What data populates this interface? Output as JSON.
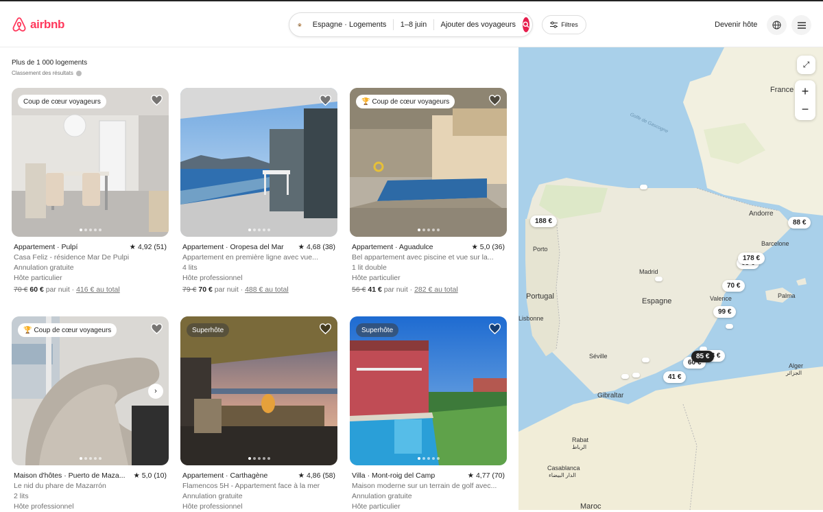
{
  "header": {
    "logo": "airbnb",
    "search": {
      "location": "Espagne · Logements",
      "dates": "1–8 juin",
      "guests": "Ajouter des voyageurs"
    },
    "filters": "Filtres",
    "host": "Devenir hôte"
  },
  "results": {
    "count": "Plus de 1 000 logements",
    "ranking": "Classement des résultats"
  },
  "listings": [
    {
      "badge": "Coup de cœur voyageurs",
      "type": "Appartement · Pulpí",
      "rating": "★ 4,92 (51)",
      "line1": "Casa Feliz - résidence Mar De Pulpi",
      "line2": "Annulation gratuite",
      "line3": "Hôte particulier",
      "old_price": "70 €",
      "price": "60 €",
      "per_night": "par nuit ·",
      "total": "416 € au total"
    },
    {
      "badge": "",
      "type": "Appartement · Oropesa del Mar",
      "rating": "★ 4,68 (38)",
      "line1": "Appartement en première ligne avec vue...",
      "line2": "4 lits",
      "line3": "Hôte professionnel",
      "old_price": "79 €",
      "price": "70 €",
      "per_night": "par nuit ·",
      "total": "488 € au total"
    },
    {
      "badge": "Coup de cœur voyageurs",
      "type": "Appartement · Aguadulce",
      "rating": "★ 5,0 (36)",
      "line1": "Bel appartement avec piscine et vue sur la...",
      "line2": "1 lit double",
      "line3": "Hôte particulier",
      "old_price": "56 €",
      "price": "41 €",
      "per_night": "par nuit ·",
      "total": "282 € au total"
    },
    {
      "badge": "Coup de cœur voyageurs",
      "type": "Maison d'hôtes · Puerto de Maza...",
      "rating": "★ 5,0 (10)",
      "line1": "Le nid du phare de Mazarrón",
      "line2": "2 lits",
      "line3": "Hôte professionnel"
    },
    {
      "badge": "Superhôte",
      "type": "Appartement · Carthagène",
      "rating": "★ 4,86 (58)",
      "line1": "Flamencos 5H - Appartement face à la mer",
      "line2": "Annulation gratuite",
      "line3": "Hôte professionnel"
    },
    {
      "badge": "Superhôte",
      "type": "Villa · Mont-roig del Camp",
      "rating": "★ 4,77 (70)",
      "line1": "Maison moderne sur un terrain de golf avec...",
      "line2": "Annulation gratuite",
      "line3": "Hôte particulier"
    }
  ],
  "map": {
    "labels": {
      "france": "France",
      "golfe": "Golfe de Gascogne",
      "andorre": "Andorre",
      "porto": "Porto",
      "barcelone": "Barcelone",
      "madrid": "Madrid",
      "portugal": "Portugal",
      "espagne": "Espagne",
      "valence": "Valence",
      "palma": "Palma",
      "lisbonne": "Lisbonne",
      "seville": "Séville",
      "gibraltar": "Gibraltar",
      "alger": "Alger",
      "alger_ar": "الجزائر",
      "rabat": "Rabat",
      "rabat_ar": "الرباط",
      "casablanca": "Casablanca",
      "casablanca_ar": "الدار البيضاء",
      "maroc": "Maroc"
    },
    "pins": {
      "p188": "188 €",
      "p88": "88 €",
      "p178": "178 €",
      "p63": "63 €",
      "p70": "70 €",
      "p99": "99 €",
      "p85": "85 €",
      "p41": "41 €",
      "p60": "60 €",
      "p58": "58 €"
    }
  },
  "colors": {
    "brand": "#ff385c",
    "search": "#e61e4d",
    "sea": "#a9d0ea",
    "land": "#f2f0e0"
  }
}
